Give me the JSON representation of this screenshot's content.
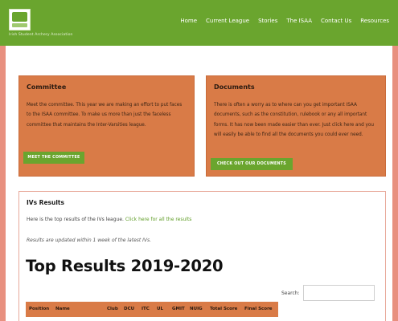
{
  "colors": {
    "brand_green": "#6aa52e",
    "card_orange": "#d97b47",
    "page_border": "#e8907f",
    "link_green": "#5f9d26"
  },
  "header": {
    "logo_icon": "association-logo",
    "tagline": "Irish Student Archery Association",
    "nav": [
      "Home",
      "Current League",
      "Stories",
      "The ISAA",
      "Contact Us",
      "Resources"
    ]
  },
  "cards": {
    "committee": {
      "title": "Committee",
      "body": "Meet the committee. This year we are making an effort to put faces to the ISAA committee. To make us more than just the faceless committee that maintains the Inter-Varsities league.",
      "button": "Meet the Committee"
    },
    "documents": {
      "title": "Documents",
      "body": "There is often a worry as to where can you get important ISAA documents, such as the constitution, rulebook or any all important forms. It has now been made easier than ever. Just click here and you will easily be able to find all the documents you could ever need.",
      "button": "Check out our Documents"
    }
  },
  "results": {
    "heading": "IVs Results",
    "intro_text": "Here is the top results of the IVs league.",
    "intro_link": "Click here for all the results",
    "note": "Results are updated within 1 week of the latest IVs.",
    "title": "Top Results 2019-2020",
    "search_label": "Search:",
    "search_value": "",
    "columns": [
      "Position",
      "Name",
      "Club",
      "DCU",
      "ITC",
      "UL",
      "GMIT",
      "NUIG",
      "Total Score",
      "Final Score"
    ]
  }
}
